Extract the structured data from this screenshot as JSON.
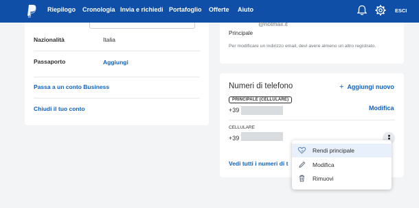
{
  "nav": {
    "items": [
      "Riepilogo",
      "Cronologia",
      "Invia e richiedi",
      "Portafoglio",
      "Offerte",
      "Aiuto"
    ],
    "logout": "ESCI"
  },
  "profile": {
    "nationality_label": "Nazionalità",
    "nationality_value": "Italia",
    "passport_label": "Passaporto",
    "passport_action": "Aggiungi",
    "business_link": "Passa a un conto Business",
    "close_link": "Chiudi il tuo conto"
  },
  "email": {
    "partial_address": "@hotmail.it",
    "primary_label": "Principale",
    "hint": "Per modificare un indirizzo email, devi avere almeno un altro registrato."
  },
  "phones": {
    "title": "Numeri di telefono",
    "add_label": "Aggiungi nuovo",
    "primary_badge": "PRINCIPALE (CELLULARE)",
    "prefix_primary": "+39",
    "edit_label": "Modifica",
    "secondary_type": "CELLULARE",
    "prefix_secondary": "+39",
    "see_all": "Vedi tutti i numeri di t"
  },
  "menu": {
    "items": [
      {
        "label": "Rendi principale",
        "icon": "heart-icon"
      },
      {
        "label": "Modifica",
        "icon": "pencil-icon"
      },
      {
        "label": "Rimuovi",
        "icon": "trash-icon"
      }
    ]
  },
  "colors": {
    "nav_bg": "#0f4fa8",
    "link": "#0d62c4",
    "page_bg": "#f2f4f6",
    "menu_highlight": "#e7f0fb"
  }
}
